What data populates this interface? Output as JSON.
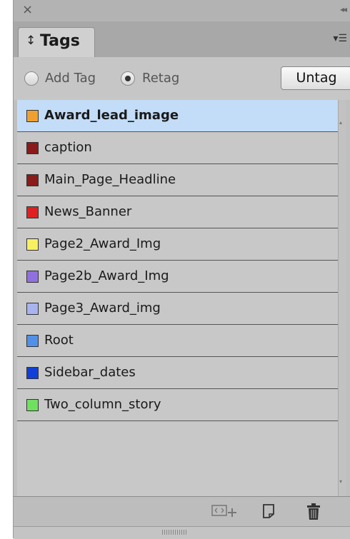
{
  "panel": {
    "tab_label": "Tags",
    "tab_arrows": "↕",
    "options": {
      "add_tag_label": "Add Tag",
      "retag_label": "Retag",
      "selected": "Retag",
      "untag_label": "Untag"
    }
  },
  "tags": [
    {
      "label": "Award_lead_image",
      "color": "#f0a030",
      "selected": true
    },
    {
      "label": "caption",
      "color": "#8b1a1a",
      "selected": false
    },
    {
      "label": "Main_Page_Headline",
      "color": "#8b1a1a",
      "selected": false
    },
    {
      "label": "News_Banner",
      "color": "#e02020",
      "selected": false
    },
    {
      "label": "Page2_Award_Img",
      "color": "#f8f060",
      "selected": false
    },
    {
      "label": "Page2b_Award_Img",
      "color": "#9070e0",
      "selected": false
    },
    {
      "label": "Page3_Award_img",
      "color": "#a8b4f0",
      "selected": false
    },
    {
      "label": "Root",
      "color": "#5090e8",
      "selected": false
    },
    {
      "label": "Sidebar_dates",
      "color": "#1040d8",
      "selected": false
    },
    {
      "label": "Two_column_story",
      "color": "#70e060",
      "selected": false
    }
  ],
  "bottom_icons": [
    "new-tag-for-object-icon",
    "new-tag-icon",
    "delete-tag-icon"
  ]
}
